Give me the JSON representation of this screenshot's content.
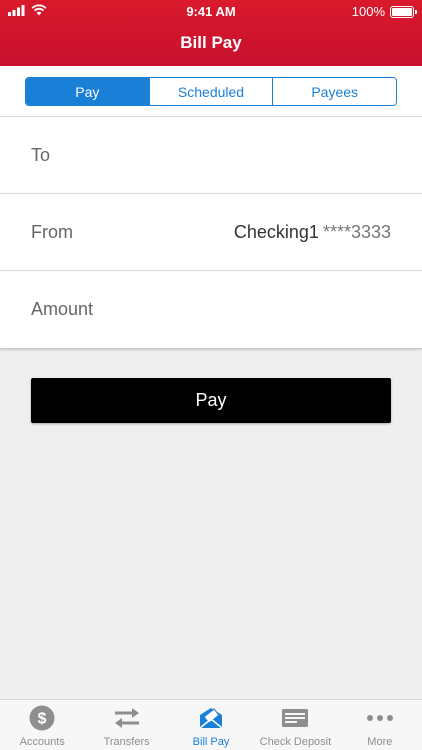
{
  "status_bar": {
    "time": "9:41 AM",
    "battery": "100%"
  },
  "header": {
    "title": "Bill Pay"
  },
  "segments": [
    {
      "label": "Pay",
      "active": true
    },
    {
      "label": "Scheduled",
      "active": false
    },
    {
      "label": "Payees",
      "active": false
    }
  ],
  "form": {
    "to_label": "To",
    "from_label": "From",
    "from_account_name": "Checking1",
    "from_account_number": "****3333",
    "amount_label": "Amount"
  },
  "pay_button": {
    "label": "Pay"
  },
  "tabbar": [
    {
      "label": "Accounts",
      "icon": "dollar-coin-icon"
    },
    {
      "label": "Transfers",
      "icon": "transfer-arrows-icon"
    },
    {
      "label": "Bill Pay",
      "icon": "bill-pay-envelope-icon",
      "active": true
    },
    {
      "label": "Check Deposit",
      "icon": "check-icon"
    },
    {
      "label": "More",
      "icon": "more-dots-icon"
    }
  ],
  "colors": {
    "header_red": "#c8102e",
    "accent_blue": "#1a7fd6",
    "tab_inactive": "#8e8e8e",
    "background": "#efefef"
  }
}
